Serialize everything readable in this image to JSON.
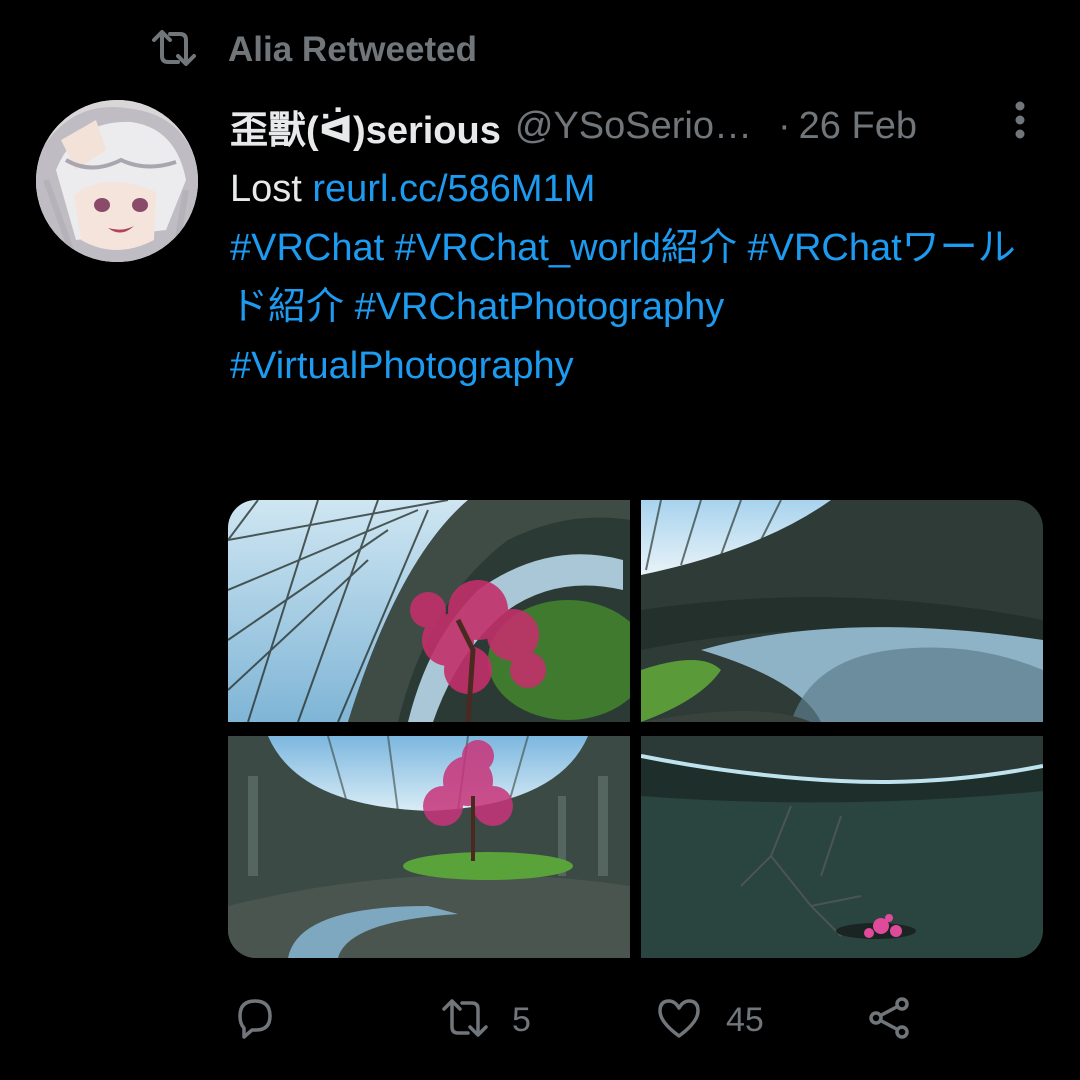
{
  "retweet_context": {
    "text": "Alia Retweeted",
    "icon": "retweet-icon"
  },
  "tweet": {
    "author": {
      "display_name": "歪獸(ᐛ)serious",
      "handle": "@YSoSerio…",
      "avatar": "anime-avatar"
    },
    "separator": "·",
    "date": "26 Feb",
    "body": {
      "lead": "Lost ",
      "link": "reurl.cc/586M1M",
      "hashtags": [
        "#VRChat",
        "#VRChat_world紹介",
        "#VRChatワールド紹介",
        "#VRChatPhotography",
        "#VirtualPhotography"
      ]
    },
    "media": [
      {
        "alt": "glass-dome-cherry-tree"
      },
      {
        "alt": "water-channel-courtyard"
      },
      {
        "alt": "circular-hall-tree-island"
      },
      {
        "alt": "dark-water-glowing-roots"
      }
    ],
    "actions": {
      "reply": {
        "icon": "reply-icon",
        "count": ""
      },
      "retweet": {
        "icon": "retweet-icon",
        "count": "5"
      },
      "like": {
        "icon": "heart-icon",
        "count": "45"
      },
      "share": {
        "icon": "share-icon"
      }
    }
  },
  "colors": {
    "background": "#000000",
    "text": "#e7e9ea",
    "muted": "#71767b",
    "link": "#1d9bf0"
  }
}
